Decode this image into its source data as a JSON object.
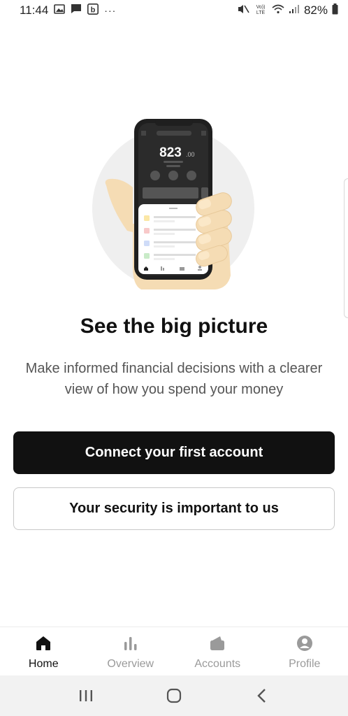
{
  "status_bar": {
    "time": "11:44",
    "more": "···",
    "battery": "82%"
  },
  "illustration": {
    "balance_main": "823",
    "balance_cents": ".00"
  },
  "hero": {
    "title": "See the big picture",
    "subtitle": "Make informed financial decisions with a clearer view of how you spend your money"
  },
  "buttons": {
    "connect": "Connect your first account",
    "security": "Your security is important to us"
  },
  "bottom_nav": {
    "items": [
      {
        "label": "Home",
        "icon": "home-icon",
        "active": true
      },
      {
        "label": "Overview",
        "icon": "bar-chart-icon",
        "active": false
      },
      {
        "label": "Accounts",
        "icon": "wallet-icon",
        "active": false
      },
      {
        "label": "Profile",
        "icon": "profile-icon",
        "active": false
      }
    ]
  },
  "colors": {
    "primary": "#111111",
    "muted": "#9a9a9a",
    "skin": "#f5dcb4",
    "circle": "#efefef"
  }
}
